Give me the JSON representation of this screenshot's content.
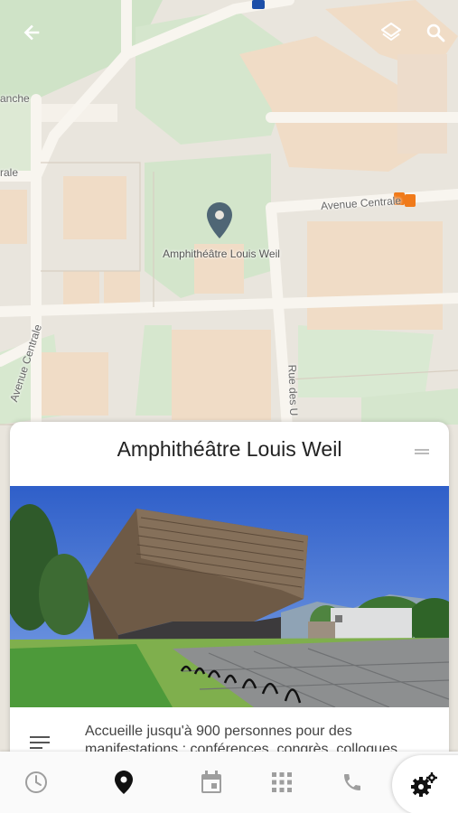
{
  "map": {
    "poi_label": "Amphithéâtre Louis Weil",
    "streets": {
      "avenue_centrale_east": "Avenue Centrale",
      "avenue_centrale_west": "Avenue Centrale",
      "rue_des_u": "Rue des U",
      "anche": "anche",
      "rale": "rale"
    },
    "marker_color": "#4f6675"
  },
  "toolbar": {
    "back_icon": "arrow-back-icon",
    "layers_icon": "layers-icon",
    "search_icon": "search-icon"
  },
  "card": {
    "title": "Amphithéâtre Louis Weil",
    "description": "Accueille jusqu'à 900 personnes pour des manifestations : conférences, congrès, colloques"
  },
  "bottom_nav": {
    "items": [
      {
        "icon": "clock-icon",
        "active": false
      },
      {
        "icon": "place-icon",
        "active": true
      },
      {
        "icon": "calendar-icon",
        "active": false
      },
      {
        "icon": "apps-grid-icon",
        "active": false
      },
      {
        "icon": "phone-icon",
        "active": false
      }
    ],
    "fab_icon": "settings-gears-icon"
  }
}
